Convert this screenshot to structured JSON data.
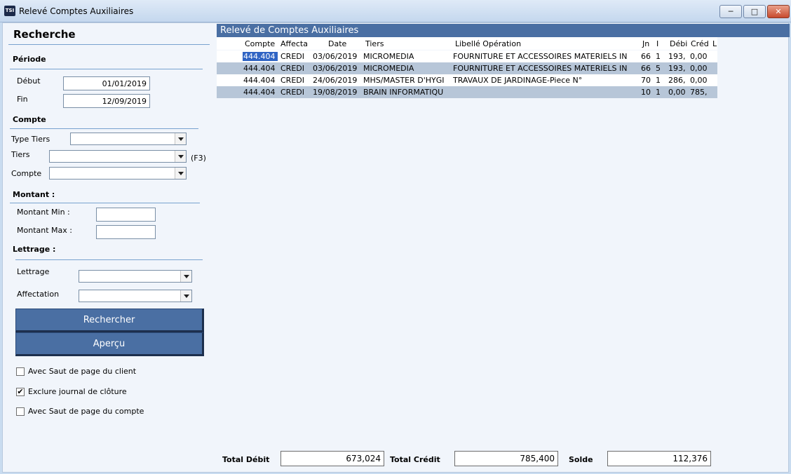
{
  "window": {
    "icon_text": "TSI",
    "title": "Relevé Comptes Auxiliaires"
  },
  "search": {
    "heading": "Recherche",
    "periode": {
      "heading": "Période",
      "debut_label": "Début",
      "debut_value": "01/01/2019",
      "fin_label": "Fin",
      "fin_value": "12/09/2019"
    },
    "compte": {
      "heading": "Compte",
      "type_tiers_label": "Type Tiers",
      "type_tiers_value": "",
      "tiers_label": "Tiers",
      "tiers_value": "",
      "tiers_hint": "(F3)",
      "compte_label": "Compte",
      "compte_value": ""
    },
    "montant": {
      "heading": "Montant :",
      "min_label": "Montant Min :",
      "min_value": "",
      "max_label": "Montant Max :",
      "max_value": ""
    },
    "lettrage": {
      "heading": "Lettrage :",
      "lettrage_label": "Lettrage",
      "lettrage_value": "",
      "affectation_label": "Affectation",
      "affectation_value": ""
    },
    "buttons": {
      "search": "Rechercher",
      "preview": "Aperçu"
    },
    "options": [
      {
        "label": "Avec Saut de page du client",
        "checked": false
      },
      {
        "label": "Exclure journal de clôture",
        "checked": true
      },
      {
        "label": "Avec Saut de page du compte",
        "checked": false
      }
    ]
  },
  "grid": {
    "title": "Relevé de Comptes Auxiliaires",
    "columns": [
      "Compte",
      "Affecta",
      "Date",
      "Tiers",
      "Libellé Opération",
      "Jn",
      "I",
      "Débi",
      "Créd",
      "L"
    ],
    "rows": [
      [
        "444.404",
        "CREDI",
        "03/06/2019",
        "MICROMEDIA",
        "FOURNITURE ET ACCESSOIRES MATERIELS IN",
        "66",
        "1",
        "193,",
        "0,00",
        ""
      ],
      [
        "444.404",
        "CREDI",
        "03/06/2019",
        "MICROMEDIA",
        "FOURNITURE ET ACCESSOIRES MATERIELS IN",
        "66",
        "5",
        "193,",
        "0,00",
        ""
      ],
      [
        "444.404",
        "CREDI",
        "24/06/2019",
        "MHS/MASTER D'HYGI",
        "TRAVAUX DE JARDINAGE-Piece N°",
        "70",
        "1",
        "286,",
        "0,00",
        ""
      ],
      [
        "444.404",
        "CREDI",
        "19/08/2019",
        "BRAIN INFORMATIQU",
        "",
        "10",
        "1",
        "0,00",
        "785,",
        ""
      ]
    ],
    "selected_row": 0
  },
  "totals": {
    "debit_label": "Total Débit",
    "debit_value": "673,024",
    "credit_label": "Total Crédit",
    "credit_value": "785,400",
    "solde_label": "Solde",
    "solde_value": "112,376"
  },
  "colors": {
    "accent": "#4a6fa3",
    "selection": "#2f64c4",
    "alt_row": "#b7c6d8"
  }
}
